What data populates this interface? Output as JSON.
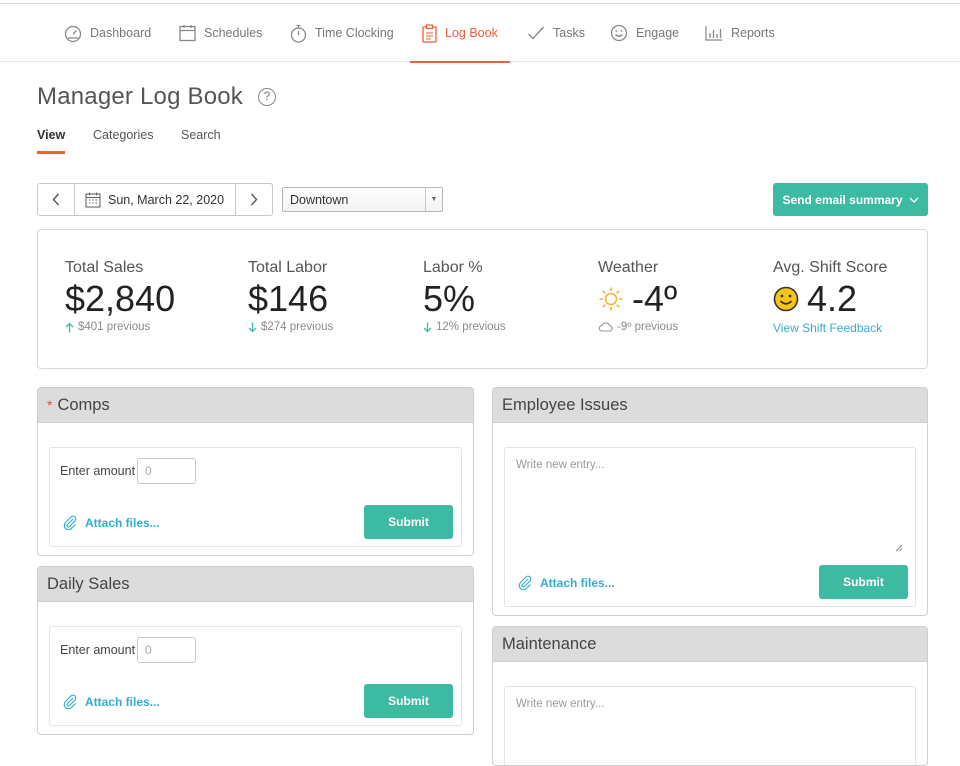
{
  "nav": {
    "items": [
      {
        "label": "Dashboard",
        "icon": "dashboard-icon"
      },
      {
        "label": "Schedules",
        "icon": "calendar-icon"
      },
      {
        "label": "Time Clocking",
        "icon": "stopwatch-icon"
      },
      {
        "label": "Log Book",
        "icon": "clipboard-icon",
        "active": true
      },
      {
        "label": "Tasks",
        "icon": "checkmark-icon"
      },
      {
        "label": "Engage",
        "icon": "smiley-icon"
      },
      {
        "label": "Reports",
        "icon": "bar-chart-icon"
      }
    ]
  },
  "page": {
    "title": "Manager Log Book",
    "help": "?",
    "subtabs": [
      "View",
      "Categories",
      "Search"
    ]
  },
  "toolbar": {
    "date": "Sun, March 22, 2020",
    "location": "Downtown",
    "email_button": "Send email summary"
  },
  "stats": {
    "sales": {
      "label": "Total Sales",
      "value": "$2,840",
      "previous": "$401 previous",
      "trend": "up"
    },
    "labor": {
      "label": "Total Labor",
      "value": "$146",
      "previous": "$274 previous",
      "trend": "down"
    },
    "labor_pct": {
      "label": "Labor %",
      "value": "5%",
      "previous": "12% previous",
      "trend": "down"
    },
    "weather": {
      "label": "Weather",
      "value": "-4º",
      "previous": "-9º previous"
    },
    "shift": {
      "label": "Avg. Shift Score",
      "value": "4.2",
      "link": "View Shift Feedback"
    }
  },
  "panels": {
    "comps": {
      "title": "Comps",
      "required": "*",
      "amount_label": "Enter amount",
      "amount_placeholder": "0",
      "attach": "Attach files...",
      "submit": "Submit"
    },
    "daily_sales": {
      "title": "Daily Sales",
      "amount_label": "Enter amount",
      "amount_placeholder": "0",
      "attach": "Attach files...",
      "submit": "Submit"
    },
    "employee_issues": {
      "title": "Employee Issues",
      "placeholder": "Write new entry...",
      "attach": "Attach files...",
      "submit": "Submit"
    },
    "maintenance": {
      "title": "Maintenance",
      "placeholder": "Write new entry..."
    }
  },
  "colors": {
    "accent": "#e8603c",
    "teal": "#3dbaa2",
    "link": "#33aed1",
    "weather_sun": "#f2b33d",
    "smiley": "#f5c518"
  }
}
